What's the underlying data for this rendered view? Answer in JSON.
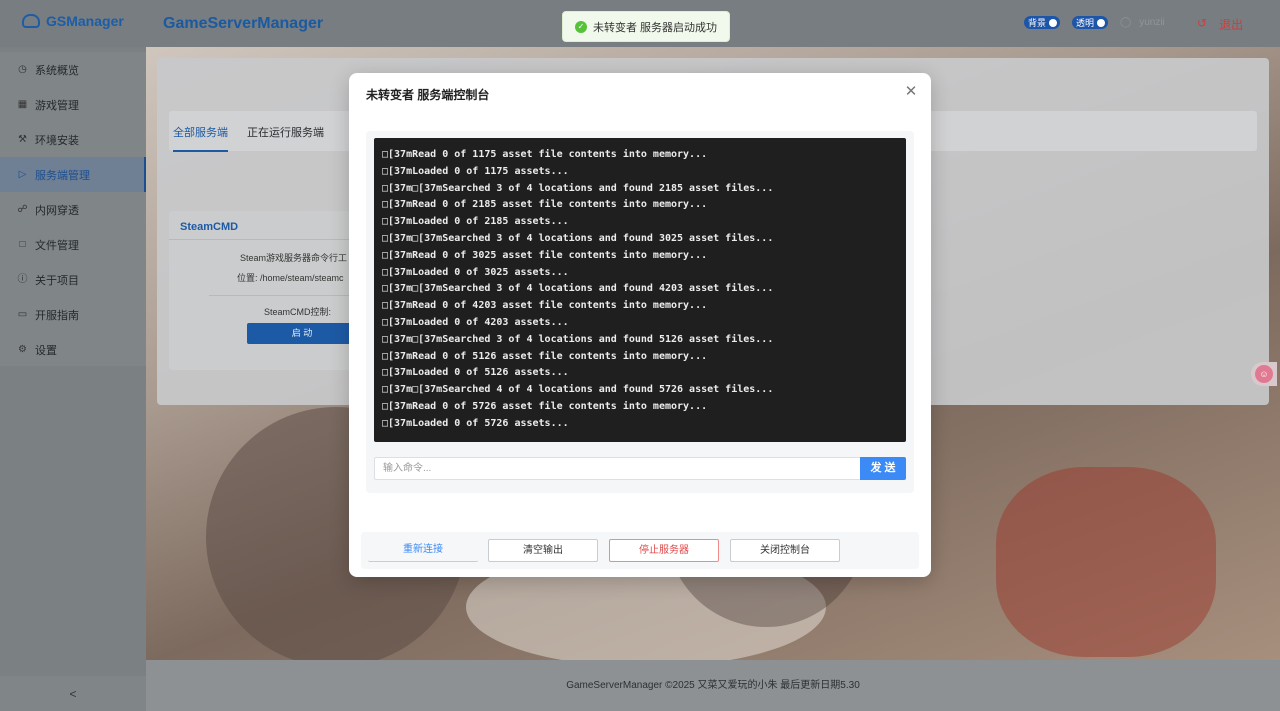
{
  "header": {
    "logo": "GSManager",
    "title": "GameServerManager",
    "toggle_bg": "背景",
    "toggle_transparent": "透明",
    "user": "yunzii",
    "logout": "退出"
  },
  "sidebar": {
    "items": [
      {
        "label": "系统概览",
        "icon": "dashboard-icon"
      },
      {
        "label": "游戏管理",
        "icon": "grid-icon"
      },
      {
        "label": "环境安装",
        "icon": "wrench-icon"
      },
      {
        "label": "服务端管理",
        "icon": "play-circle-icon"
      },
      {
        "label": "内网穿透",
        "icon": "globe-icon"
      },
      {
        "label": "文件管理",
        "icon": "folder-icon"
      },
      {
        "label": "关于项目",
        "icon": "info-icon"
      },
      {
        "label": "开服指南",
        "icon": "document-icon"
      },
      {
        "label": "设置",
        "icon": "gear-icon"
      }
    ],
    "collapse": "<"
  },
  "main": {
    "tabs": [
      "全部服务端",
      "正在运行服务端"
    ],
    "steamcmd": {
      "title": "SteamCMD",
      "desc": "Steam游戏服务器命令行工",
      "location": "位置: /home/steam/steamc",
      "control_label": "SteamCMD控制:",
      "start_button": "启 动"
    }
  },
  "toast": {
    "message": "未转变者 服务器启动成功"
  },
  "modal": {
    "title": "未转变者 服务端控制台",
    "console_lines": [
      "[37mRead 0 of 1175 asset file contents into memory...",
      "[37mLoaded 0 of 1175 assets...",
      "[37m[37mSearched 3 of 4 locations and found 2185 asset files...",
      "[37mRead 0 of 2185 asset file contents into memory...",
      "[37mLoaded 0 of 2185 assets...",
      "[37m[37mSearched 3 of 4 locations and found 3025 asset files...",
      "[37mRead 0 of 3025 asset file contents into memory...",
      "[37mLoaded 0 of 3025 assets...",
      "[37m[37mSearched 3 of 4 locations and found 4203 asset files...",
      "[37mRead 0 of 4203 asset file contents into memory...",
      "[37mLoaded 0 of 4203 assets...",
      "[37m[37mSearched 3 of 4 locations and found 5126 asset files...",
      "[37mRead 0 of 5126 asset file contents into memory...",
      "[37mLoaded 0 of 5126 assets...",
      "[37m[37mSearched 4 of 4 locations and found 5726 asset files...",
      "[37mRead 0 of 5726 asset file contents into memory...",
      "[37mLoaded 0 of 5726 assets..."
    ],
    "input_placeholder": "输入命令...",
    "send": "发 送",
    "buttons": {
      "reconnect": "重新连接",
      "clear": "清空输出",
      "stop": "停止服务器",
      "close": "关闭控制台"
    }
  },
  "footer": {
    "text": "GameServerManager ©2025 又菜又爱玩的小朱 最后更新日期5.30"
  },
  "colors": {
    "primary": "#1d5aa5",
    "send_button": "#3c8af5",
    "danger": "#e04848",
    "success": "#56c23a",
    "terminal_bg": "#1f1f1f"
  }
}
